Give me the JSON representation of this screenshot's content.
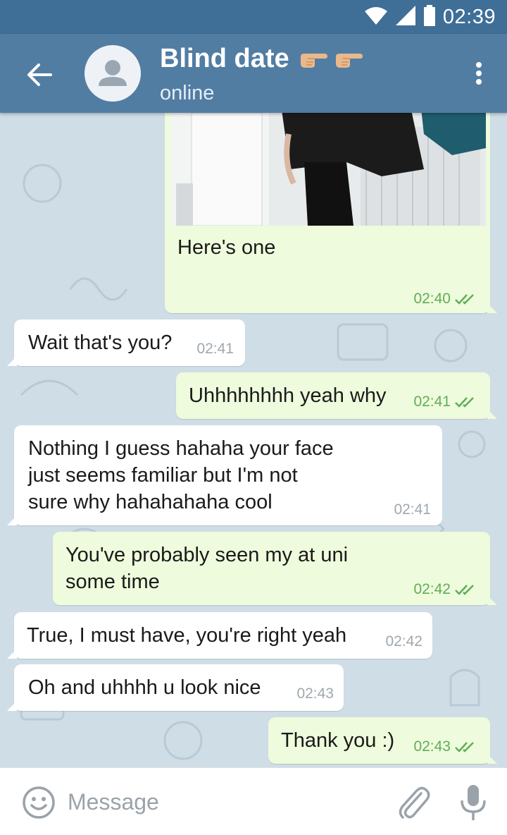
{
  "status_bar": {
    "time": "02:39",
    "icons": [
      "wifi-icon",
      "signal-icon",
      "battery-icon"
    ]
  },
  "header": {
    "title": "Blind date",
    "title_emoji": [
      "pointing-right-hand-emoji",
      "pointing-right-hand-emoji"
    ],
    "status": "online",
    "back_icon": "arrow-left-icon",
    "avatar_icon": "user-avatar-icon",
    "menu_icon": "more-vertical-icon"
  },
  "messages": [
    {
      "direction": "out",
      "type": "photo",
      "caption": "Here's one",
      "time": "02:40",
      "read": true
    },
    {
      "direction": "in",
      "lines": [
        "Wait that's you?"
      ],
      "time": "02:41"
    },
    {
      "direction": "out",
      "lines": [
        "Uhhhhhhhh yeah why"
      ],
      "time": "02:41",
      "read": true
    },
    {
      "direction": "in",
      "lines": [
        "Nothing I guess hahaha your face",
        "just seems familiar but I'm not",
        "sure why hahahahaha cool"
      ],
      "time": "02:41"
    },
    {
      "direction": "out",
      "lines": [
        "You've probably seen my at uni",
        "some time"
      ],
      "time": "02:42",
      "read": true
    },
    {
      "direction": "in",
      "lines": [
        "True, I must have, you're right yeah"
      ],
      "time": "02:42"
    },
    {
      "direction": "in",
      "lines": [
        "Oh and uhhhh u look nice"
      ],
      "time": "02:43"
    },
    {
      "direction": "out",
      "lines": [
        "Thank you :)"
      ],
      "time": "02:43",
      "read": true
    }
  ],
  "input": {
    "placeholder": "Message",
    "value": "",
    "icons": [
      "emoji-icon",
      "paperclip-icon",
      "microphone-icon"
    ]
  },
  "colors": {
    "status_bar": "#3f6e96",
    "header": "#527da3",
    "chat_background": "#cfdde6",
    "incoming_bubble": "#ffffff",
    "outgoing_bubble": "#eefbdc",
    "read_check": "#5fae57"
  }
}
